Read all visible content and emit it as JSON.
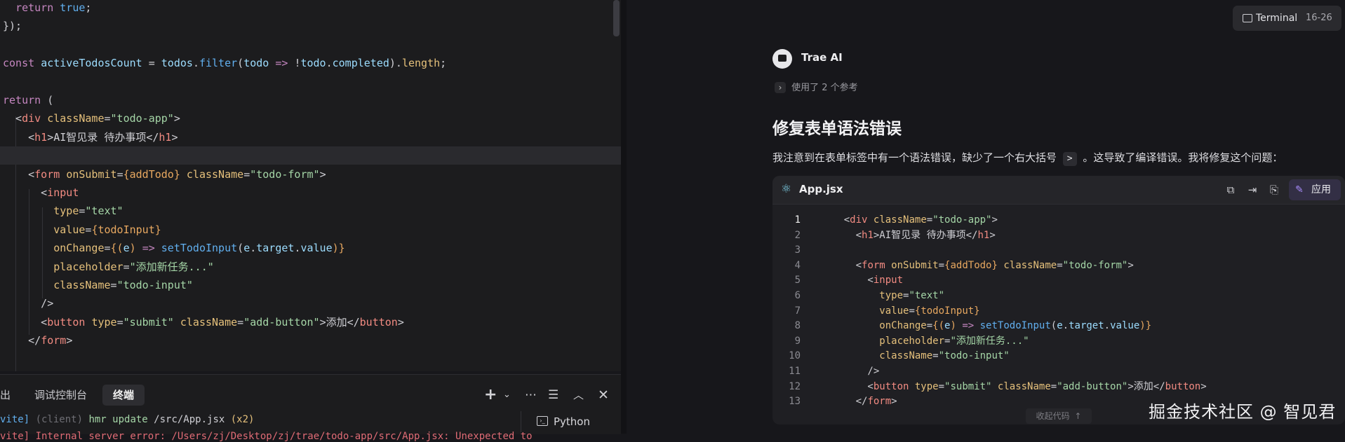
{
  "editor": {
    "lines": [
      [
        {
          "t": "  ",
          "c": "p"
        },
        {
          "t": "return",
          "c": "k"
        },
        {
          "t": " ",
          "c": "p"
        },
        {
          "t": "true",
          "c": "f"
        },
        {
          "t": ";",
          "c": "p"
        }
      ],
      [
        {
          "t": "});",
          "c": "p"
        }
      ],
      [],
      [
        {
          "t": "const",
          "c": "k"
        },
        {
          "t": " ",
          "c": "p"
        },
        {
          "t": "activeTodosCount",
          "c": "v"
        },
        {
          "t": " = ",
          "c": "p"
        },
        {
          "t": "todos",
          "c": "v"
        },
        {
          "t": ".",
          "c": "p"
        },
        {
          "t": "filter",
          "c": "f"
        },
        {
          "t": "(",
          "c": "p"
        },
        {
          "t": "todo",
          "c": "v"
        },
        {
          "t": " => ",
          "c": "k"
        },
        {
          "t": "!",
          "c": "p"
        },
        {
          "t": "todo",
          "c": "v"
        },
        {
          "t": ".",
          "c": "p"
        },
        {
          "t": "completed",
          "c": "v"
        },
        {
          "t": ").",
          "c": "p"
        },
        {
          "t": "length",
          "c": "a"
        },
        {
          "t": ";",
          "c": "p"
        }
      ],
      [],
      [
        {
          "t": "return",
          "c": "k"
        },
        {
          "t": " (",
          "c": "p"
        }
      ],
      [
        {
          "t": "  <",
          "c": "p"
        },
        {
          "t": "div",
          "c": "t"
        },
        {
          "t": " ",
          "c": "p"
        },
        {
          "t": "className",
          "c": "a"
        },
        {
          "t": "=",
          "c": "p"
        },
        {
          "t": "\"todo-app\"",
          "c": "s"
        },
        {
          "t": ">",
          "c": "p"
        }
      ],
      [
        {
          "t": "    <",
          "c": "p"
        },
        {
          "t": "h1",
          "c": "t"
        },
        {
          "t": ">AI智见录 待办事项</",
          "c": "p"
        },
        {
          "t": "h1",
          "c": "t"
        },
        {
          "t": ">",
          "c": "p"
        }
      ],
      [],
      [
        {
          "t": "    <",
          "c": "p"
        },
        {
          "t": "form",
          "c": "t"
        },
        {
          "t": " ",
          "c": "p"
        },
        {
          "t": "onSubmit",
          "c": "a"
        },
        {
          "t": "=",
          "c": "p"
        },
        {
          "t": "{addTodo}",
          "c": "b"
        },
        {
          "t": " ",
          "c": "p"
        },
        {
          "t": "className",
          "c": "a"
        },
        {
          "t": "=",
          "c": "p"
        },
        {
          "t": "\"todo-form\"",
          "c": "s"
        },
        {
          "t": ">",
          "c": "p"
        }
      ],
      [
        {
          "t": "      <",
          "c": "p"
        },
        {
          "t": "input",
          "c": "t"
        }
      ],
      [
        {
          "t": "        ",
          "c": "p"
        },
        {
          "t": "type",
          "c": "a"
        },
        {
          "t": "=",
          "c": "p"
        },
        {
          "t": "\"text\"",
          "c": "s"
        }
      ],
      [
        {
          "t": "        ",
          "c": "p"
        },
        {
          "t": "value",
          "c": "a"
        },
        {
          "t": "=",
          "c": "p"
        },
        {
          "t": "{todoInput}",
          "c": "b"
        }
      ],
      [
        {
          "t": "        ",
          "c": "p"
        },
        {
          "t": "onChange",
          "c": "a"
        },
        {
          "t": "=",
          "c": "p"
        },
        {
          "t": "{(",
          "c": "b"
        },
        {
          "t": "e",
          "c": "v"
        },
        {
          "t": ") ",
          "c": "b"
        },
        {
          "t": "=>",
          "c": "k"
        },
        {
          "t": " ",
          "c": "p"
        },
        {
          "t": "setTodoInput",
          "c": "f"
        },
        {
          "t": "(",
          "c": "p"
        },
        {
          "t": "e",
          "c": "v"
        },
        {
          "t": ".",
          "c": "p"
        },
        {
          "t": "target",
          "c": "v"
        },
        {
          "t": ".",
          "c": "p"
        },
        {
          "t": "value",
          "c": "v"
        },
        {
          "t": ")}",
          "c": "b"
        }
      ],
      [
        {
          "t": "        ",
          "c": "p"
        },
        {
          "t": "placeholder",
          "c": "a"
        },
        {
          "t": "=",
          "c": "p"
        },
        {
          "t": "\"添加新任务...\"",
          "c": "s"
        }
      ],
      [
        {
          "t": "        ",
          "c": "p"
        },
        {
          "t": "className",
          "c": "a"
        },
        {
          "t": "=",
          "c": "p"
        },
        {
          "t": "\"todo-input\"",
          "c": "s"
        }
      ],
      [
        {
          "t": "      />",
          "c": "p"
        }
      ],
      [
        {
          "t": "      <",
          "c": "p"
        },
        {
          "t": "button",
          "c": "t"
        },
        {
          "t": " ",
          "c": "p"
        },
        {
          "t": "type",
          "c": "a"
        },
        {
          "t": "=",
          "c": "p"
        },
        {
          "t": "\"submit\"",
          "c": "s"
        },
        {
          "t": " ",
          "c": "p"
        },
        {
          "t": "className",
          "c": "a"
        },
        {
          "t": "=",
          "c": "p"
        },
        {
          "t": "\"add-button\"",
          "c": "s"
        },
        {
          "t": ">添加</",
          "c": "p"
        },
        {
          "t": "button",
          "c": "t"
        },
        {
          "t": ">",
          "c": "p"
        }
      ],
      [
        {
          "t": "    </",
          "c": "p"
        },
        {
          "t": "form",
          "c": "t"
        },
        {
          "t": ">",
          "c": "p"
        }
      ]
    ],
    "active_line": 8
  },
  "panel": {
    "tab_output_partial": "出",
    "tab_debug_console": "调试控制台",
    "tab_terminal": "终端",
    "terminal_lines": [
      [
        {
          "t": "vite] ",
          "c": "f"
        },
        {
          "t": "(client) ",
          "c": "gray"
        },
        {
          "t": "hmr update ",
          "c": "s"
        },
        {
          "t": "/src/App.jsx ",
          "c": "p"
        },
        {
          "t": "(x2)",
          "c": "a"
        }
      ],
      [
        {
          "t": "vite] Internal server error: /Users/zj/Desktop/zj/trae/todo-app/src/App.jsx: Unexpected to",
          "c": "err"
        }
      ]
    ],
    "python_tab": "Python"
  },
  "terminal_chip": {
    "label": "Terminal",
    "range": "16-26"
  },
  "ai": {
    "name": "Trae AI",
    "refs": "使用了 2 个参考",
    "heading": "修复表单语法错误",
    "para_before": "我注意到在表单标签中有一个语法错误，缺少了一个右大括号",
    "para_code": ">",
    "para_after": "。这导致了编译错误。我将修复这个问题：",
    "file_name": "App.jsx",
    "apply_label": "应用",
    "collapse_label": "收起代码",
    "code_lines": [
      [
        {
          "t": "    <",
          "c": "p"
        },
        {
          "t": "div",
          "c": "t"
        },
        {
          "t": " ",
          "c": "p"
        },
        {
          "t": "className",
          "c": "a"
        },
        {
          "t": "=",
          "c": "p"
        },
        {
          "t": "\"todo-app\"",
          "c": "s"
        },
        {
          "t": ">",
          "c": "p"
        }
      ],
      [
        {
          "t": "      <",
          "c": "p"
        },
        {
          "t": "h1",
          "c": "t"
        },
        {
          "t": ">AI智见录 待办事项</",
          "c": "p"
        },
        {
          "t": "h1",
          "c": "t"
        },
        {
          "t": ">",
          "c": "p"
        }
      ],
      [],
      [
        {
          "t": "      <",
          "c": "p"
        },
        {
          "t": "form",
          "c": "t"
        },
        {
          "t": " ",
          "c": "p"
        },
        {
          "t": "onSubmit",
          "c": "a"
        },
        {
          "t": "=",
          "c": "p"
        },
        {
          "t": "{addTodo}",
          "c": "b"
        },
        {
          "t": " ",
          "c": "p"
        },
        {
          "t": "className",
          "c": "a"
        },
        {
          "t": "=",
          "c": "p"
        },
        {
          "t": "\"todo-form\"",
          "c": "s"
        },
        {
          "t": ">",
          "c": "p"
        }
      ],
      [
        {
          "t": "        <",
          "c": "p"
        },
        {
          "t": "input",
          "c": "t"
        }
      ],
      [
        {
          "t": "          ",
          "c": "p"
        },
        {
          "t": "type",
          "c": "a"
        },
        {
          "t": "=",
          "c": "p"
        },
        {
          "t": "\"text\"",
          "c": "s"
        }
      ],
      [
        {
          "t": "          ",
          "c": "p"
        },
        {
          "t": "value",
          "c": "a"
        },
        {
          "t": "=",
          "c": "p"
        },
        {
          "t": "{todoInput}",
          "c": "b"
        }
      ],
      [
        {
          "t": "          ",
          "c": "p"
        },
        {
          "t": "onChange",
          "c": "a"
        },
        {
          "t": "=",
          "c": "p"
        },
        {
          "t": "{(",
          "c": "b"
        },
        {
          "t": "e",
          "c": "v"
        },
        {
          "t": ") ",
          "c": "b"
        },
        {
          "t": "=>",
          "c": "k"
        },
        {
          "t": " ",
          "c": "p"
        },
        {
          "t": "setTodoInput",
          "c": "f"
        },
        {
          "t": "(",
          "c": "p"
        },
        {
          "t": "e",
          "c": "v"
        },
        {
          "t": ".",
          "c": "p"
        },
        {
          "t": "target",
          "c": "v"
        },
        {
          "t": ".",
          "c": "p"
        },
        {
          "t": "value",
          "c": "v"
        },
        {
          "t": ")}",
          "c": "b"
        }
      ],
      [
        {
          "t": "          ",
          "c": "p"
        },
        {
          "t": "placeholder",
          "c": "a"
        },
        {
          "t": "=",
          "c": "p"
        },
        {
          "t": "\"添加新任务...\"",
          "c": "s"
        }
      ],
      [
        {
          "t": "          ",
          "c": "p"
        },
        {
          "t": "className",
          "c": "a"
        },
        {
          "t": "=",
          "c": "p"
        },
        {
          "t": "\"todo-input\"",
          "c": "s"
        }
      ],
      [
        {
          "t": "        />",
          "c": "p"
        }
      ],
      [
        {
          "t": "        <",
          "c": "p"
        },
        {
          "t": "button",
          "c": "t"
        },
        {
          "t": " ",
          "c": "p"
        },
        {
          "t": "type",
          "c": "a"
        },
        {
          "t": "=",
          "c": "p"
        },
        {
          "t": "\"submit\"",
          "c": "s"
        },
        {
          "t": " ",
          "c": "p"
        },
        {
          "t": "className",
          "c": "a"
        },
        {
          "t": "=",
          "c": "p"
        },
        {
          "t": "\"add-button\"",
          "c": "s"
        },
        {
          "t": ">添加</",
          "c": "p"
        },
        {
          "t": "button",
          "c": "t"
        },
        {
          "t": ">",
          "c": "p"
        }
      ],
      [
        {
          "t": "      </",
          "c": "p"
        },
        {
          "t": "form",
          "c": "t"
        },
        {
          "t": ">",
          "c": "p"
        }
      ]
    ]
  },
  "watermark": "掘金技术社区 @ 智见君",
  "colors": {
    "accent": "#a78bfa",
    "editor_bg": "#1c1c1e",
    "panel_bg": "#17171b"
  }
}
